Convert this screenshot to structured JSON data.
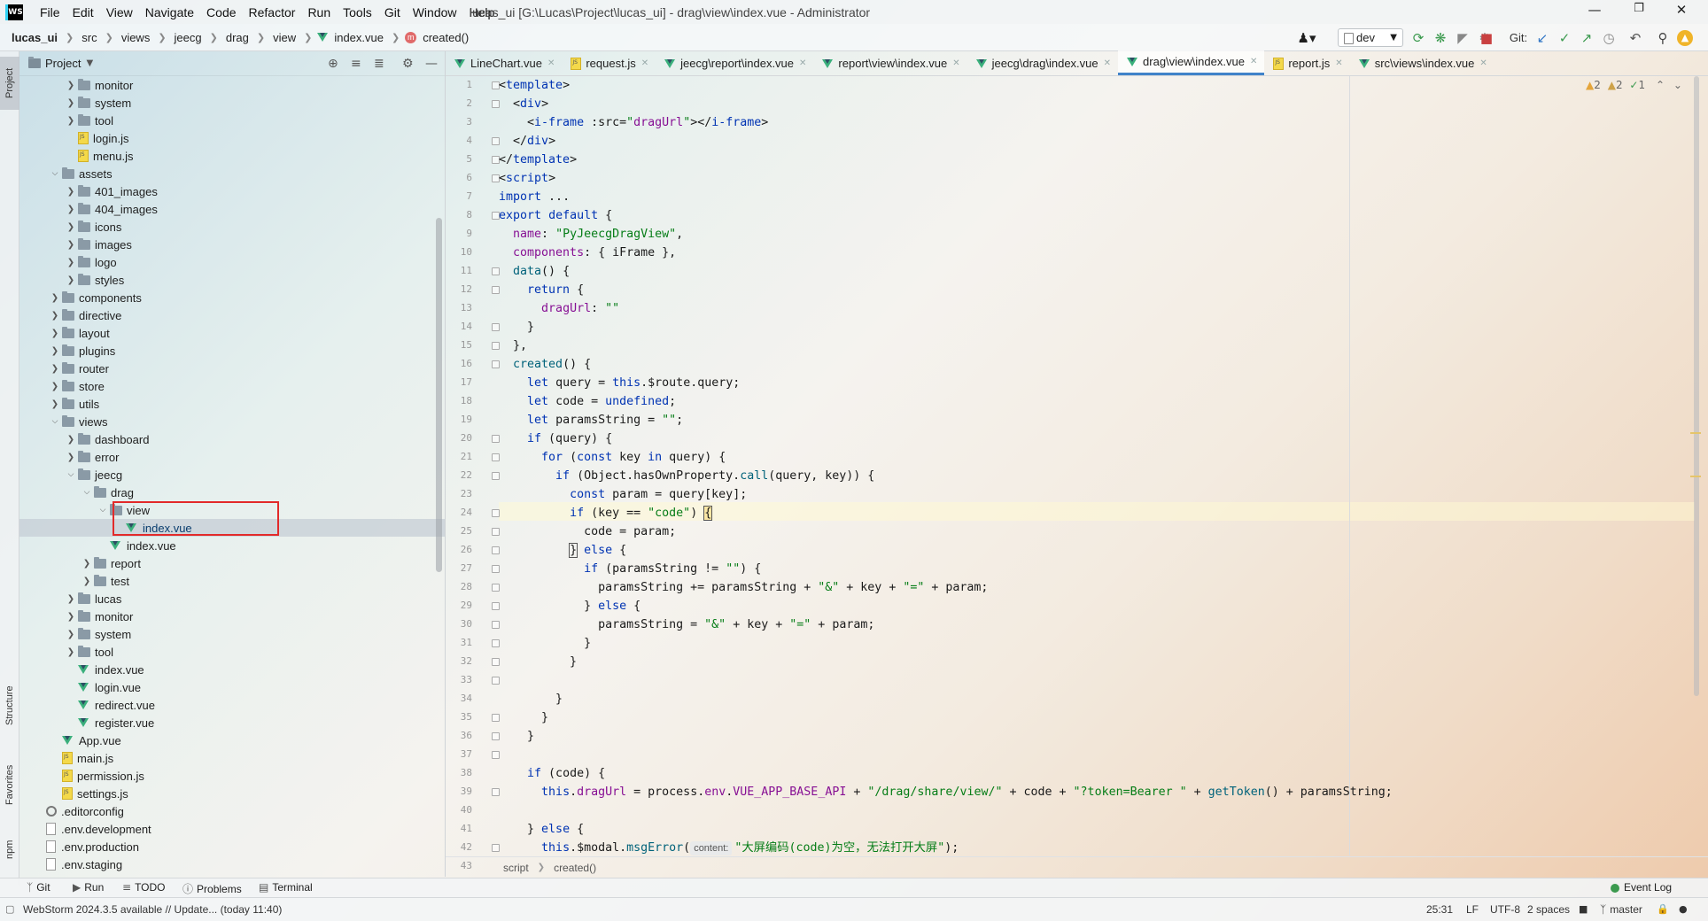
{
  "menubar": {
    "logo": "WS",
    "items": [
      "File",
      "Edit",
      "View",
      "Navigate",
      "Code",
      "Refactor",
      "Run",
      "Tools",
      "Git",
      "Window",
      "Help"
    ],
    "title": "lucas_ui [G:\\Lucas\\Project\\lucas_ui] - drag\\view\\index.vue - Administrator"
  },
  "navbar": {
    "crumbs": [
      "lucas_ui",
      "src",
      "views",
      "jeecg",
      "drag",
      "view",
      "index.vue",
      "created()"
    ],
    "branch_select": "dev",
    "git_label": "Git:"
  },
  "project": {
    "title": "Project"
  },
  "tree": [
    {
      "label": "monitor",
      "type": "folder",
      "depth": 3,
      "arrow": "right"
    },
    {
      "label": "system",
      "type": "folder",
      "depth": 3,
      "arrow": "right"
    },
    {
      "label": "tool",
      "type": "folder",
      "depth": 3,
      "arrow": "right"
    },
    {
      "label": "login.js",
      "type": "js",
      "depth": 3
    },
    {
      "label": "menu.js",
      "type": "js",
      "depth": 3
    },
    {
      "label": "assets",
      "type": "folder",
      "depth": 2,
      "arrow": "down"
    },
    {
      "label": "401_images",
      "type": "folder",
      "depth": 3,
      "arrow": "right"
    },
    {
      "label": "404_images",
      "type": "folder",
      "depth": 3,
      "arrow": "right"
    },
    {
      "label": "icons",
      "type": "folder",
      "depth": 3,
      "arrow": "right"
    },
    {
      "label": "images",
      "type": "folder",
      "depth": 3,
      "arrow": "right"
    },
    {
      "label": "logo",
      "type": "folder",
      "depth": 3,
      "arrow": "right"
    },
    {
      "label": "styles",
      "type": "folder",
      "depth": 3,
      "arrow": "right"
    },
    {
      "label": "components",
      "type": "folder",
      "depth": 2,
      "arrow": "right"
    },
    {
      "label": "directive",
      "type": "folder",
      "depth": 2,
      "arrow": "right"
    },
    {
      "label": "layout",
      "type": "folder",
      "depth": 2,
      "arrow": "right"
    },
    {
      "label": "plugins",
      "type": "folder",
      "depth": 2,
      "arrow": "right"
    },
    {
      "label": "router",
      "type": "folder",
      "depth": 2,
      "arrow": "right"
    },
    {
      "label": "store",
      "type": "folder",
      "depth": 2,
      "arrow": "right"
    },
    {
      "label": "utils",
      "type": "folder",
      "depth": 2,
      "arrow": "right"
    },
    {
      "label": "views",
      "type": "folder",
      "depth": 2,
      "arrow": "down"
    },
    {
      "label": "dashboard",
      "type": "folder",
      "depth": 3,
      "arrow": "right"
    },
    {
      "label": "error",
      "type": "folder",
      "depth": 3,
      "arrow": "right"
    },
    {
      "label": "jeecg",
      "type": "folder",
      "depth": 3,
      "arrow": "down"
    },
    {
      "label": "drag",
      "type": "folder",
      "depth": 4,
      "arrow": "down"
    },
    {
      "label": "view",
      "type": "folder",
      "depth": 5,
      "arrow": "down"
    },
    {
      "label": "index.vue",
      "type": "vue",
      "depth": 6,
      "selected": true
    },
    {
      "label": "index.vue",
      "type": "vue",
      "depth": 5
    },
    {
      "label": "report",
      "type": "folder",
      "depth": 4,
      "arrow": "right"
    },
    {
      "label": "test",
      "type": "folder",
      "depth": 4,
      "arrow": "right"
    },
    {
      "label": "lucas",
      "type": "folder",
      "depth": 3,
      "arrow": "right"
    },
    {
      "label": "monitor",
      "type": "folder",
      "depth": 3,
      "arrow": "right"
    },
    {
      "label": "system",
      "type": "folder",
      "depth": 3,
      "arrow": "right"
    },
    {
      "label": "tool",
      "type": "folder",
      "depth": 3,
      "arrow": "right"
    },
    {
      "label": "index.vue",
      "type": "vue",
      "depth": 3
    },
    {
      "label": "login.vue",
      "type": "vue",
      "depth": 3
    },
    {
      "label": "redirect.vue",
      "type": "vue",
      "depth": 3
    },
    {
      "label": "register.vue",
      "type": "vue",
      "depth": 3
    },
    {
      "label": "App.vue",
      "type": "vue",
      "depth": 2
    },
    {
      "label": "main.js",
      "type": "js",
      "depth": 2
    },
    {
      "label": "permission.js",
      "type": "js",
      "depth": 2
    },
    {
      "label": "settings.js",
      "type": "js",
      "depth": 2
    },
    {
      "label": ".editorconfig",
      "type": "cfg",
      "depth": 1
    },
    {
      "label": ".env.development",
      "type": "env",
      "depth": 1
    },
    {
      "label": ".env.production",
      "type": "env",
      "depth": 1
    },
    {
      "label": ".env.staging",
      "type": "env",
      "depth": 1
    }
  ],
  "tabs": [
    {
      "label": "LineChart.vue",
      "icon": "vue"
    },
    {
      "label": "request.js",
      "icon": "js"
    },
    {
      "label": "jeecg\\report\\index.vue",
      "icon": "vue"
    },
    {
      "label": "report\\view\\index.vue",
      "icon": "vue"
    },
    {
      "label": "jeecg\\drag\\index.vue",
      "icon": "vue"
    },
    {
      "label": "drag\\view\\index.vue",
      "icon": "vue",
      "active": true
    },
    {
      "label": "report.js",
      "icon": "js"
    },
    {
      "label": "src\\views\\index.vue",
      "icon": "vue"
    }
  ],
  "inspections": {
    "warn_a": "2",
    "warn_b": "2",
    "ok": "1"
  },
  "code_breadcrumb": [
    "script",
    "created()"
  ],
  "bottom_tools": [
    "Git",
    "Run",
    "TODO",
    "Problems",
    "Terminal",
    "Event Log"
  ],
  "side_tabs": [
    "Project",
    "Structure",
    "Favorites",
    "npm"
  ],
  "status": {
    "message": "WebStorm 2024.3.5 available // Update... (today 11:40)",
    "position": "25:31",
    "line_sep": "LF",
    "encoding": "UTF-8",
    "indent": "2 spaces",
    "branch": "master"
  },
  "colors": {
    "accent": "#4083c9",
    "highlight_box": "#e22a2a",
    "vue_green": "#3bb07c"
  }
}
